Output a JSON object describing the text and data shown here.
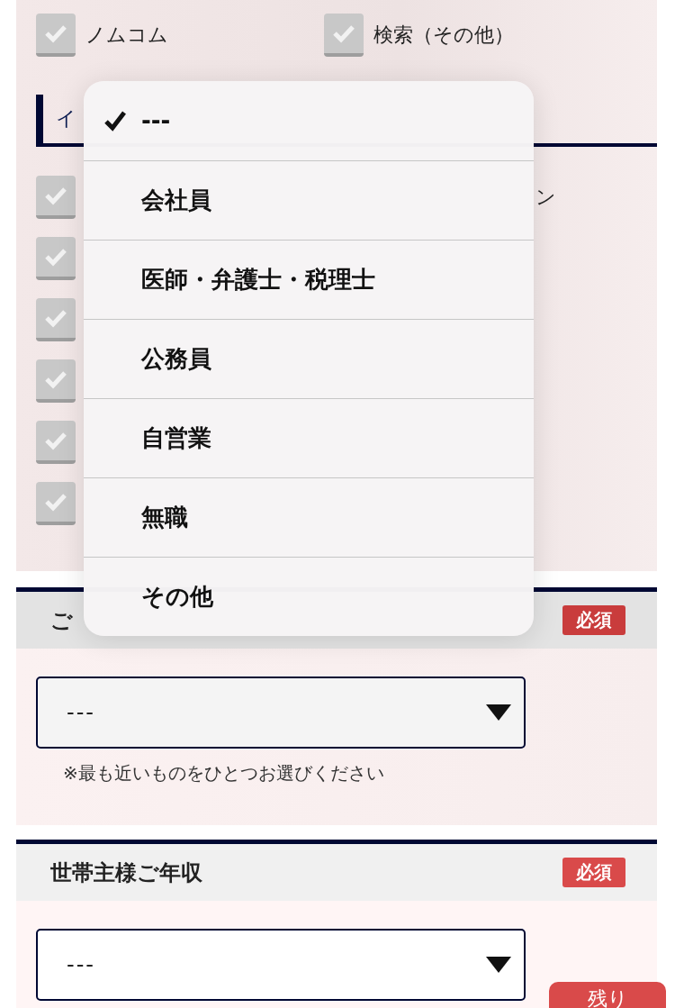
{
  "source_section": {
    "options": [
      {
        "label": "ノムコム",
        "checked": false
      },
      {
        "label": "検索（その他）",
        "checked": false
      }
    ]
  },
  "interest_section": {
    "title": "イ",
    "rows": [
      {
        "checked": false,
        "fragment": "ン"
      },
      {
        "checked": false
      },
      {
        "checked": false
      },
      {
        "checked": false
      },
      {
        "checked": false
      },
      {
        "checked": false
      }
    ]
  },
  "occupation_section": {
    "title": "ご",
    "required_badge": "必須",
    "select": {
      "value": "---"
    },
    "note": "※最も近いものをひとつお選びください"
  },
  "income_section": {
    "title": "世帯主様ご年収",
    "required_badge": "必須",
    "select": {
      "value": "---"
    }
  },
  "remaining_button": "残り",
  "dropdown_menu": {
    "options": [
      {
        "label": "---",
        "selected": true
      },
      {
        "label": "会社員",
        "selected": false
      },
      {
        "label": "医師・弁護士・税理士",
        "selected": false
      },
      {
        "label": "公務員",
        "selected": false
      },
      {
        "label": "自営業",
        "selected": false
      },
      {
        "label": "無職",
        "selected": false
      },
      {
        "label": "その他",
        "selected": false
      }
    ]
  }
}
